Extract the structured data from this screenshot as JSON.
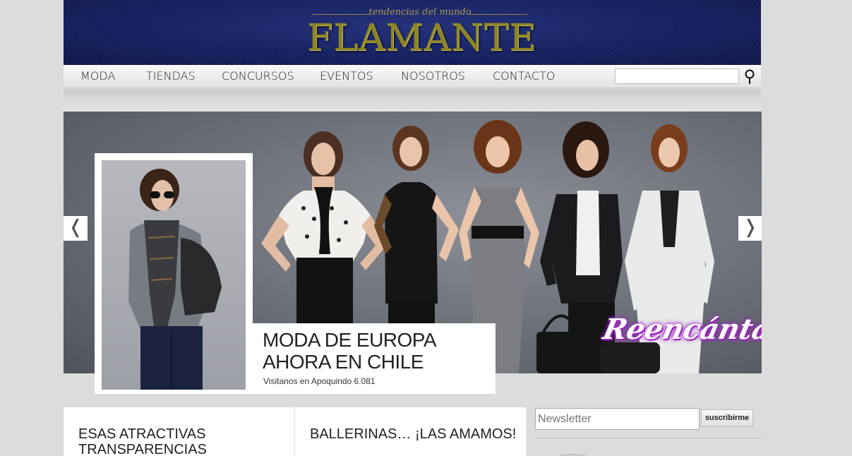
{
  "header": {
    "tagline": "tendencias del mundo",
    "logo": "FLAMANTE"
  },
  "nav": {
    "items": [
      {
        "label": "MODA"
      },
      {
        "label": "TIENDAS"
      },
      {
        "label": "CONCURSOS"
      },
      {
        "label": "EVENTOS"
      },
      {
        "label": "NOSOTROS"
      },
      {
        "label": "CONTACTO"
      }
    ],
    "search": {
      "value": "",
      "icon": "search-icon"
    }
  },
  "slider": {
    "brand_script": "Reencántate",
    "prev_icon": "chevron-left-icon",
    "next_icon": "chevron-right-icon",
    "prev_glyph": "❬",
    "next_glyph": "❭"
  },
  "featured": {
    "title": "MODA DE EUROPA\nAHORA EN CHILE",
    "subtitle": "Visitanos en Apoquindo 6.081"
  },
  "posts": [
    {
      "title": "ESAS ATRACTIVAS\nTRANSPARENCIAS"
    },
    {
      "title": "BALLERINAS… ¡LAS AMAMOS!"
    }
  ],
  "newsletter": {
    "placeholder": "Newsletter",
    "button_label": "suscribirme"
  },
  "colors": {
    "header_bg": "#162060",
    "logo_gold": "#8c8426",
    "accent_script": "#9b27c1"
  }
}
